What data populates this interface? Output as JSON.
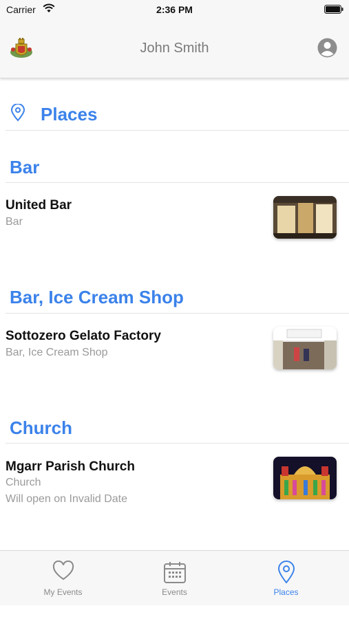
{
  "status_bar": {
    "carrier": "Carrier",
    "time": "2:36 PM"
  },
  "header": {
    "title": "John Smith",
    "logo_icon": "coat-of-arms-icon",
    "profile_icon": "person-circle-icon"
  },
  "page": {
    "title": "Places",
    "icon": "map-pin-icon"
  },
  "sections": [
    {
      "title": "Bar",
      "items": [
        {
          "name": "United Bar",
          "category": "Bar",
          "note": ""
        }
      ]
    },
    {
      "title": "Bar, Ice Cream Shop",
      "items": [
        {
          "name": "Sottozero Gelato Factory",
          "category": "Bar, Ice Cream Shop",
          "note": ""
        }
      ]
    },
    {
      "title": "Church",
      "items": [
        {
          "name": "Mgarr Parish Church",
          "category": "Church",
          "note": "Will open on Invalid Date"
        }
      ]
    }
  ],
  "tabs": [
    {
      "label": "My Events",
      "icon": "heart-icon",
      "active": false
    },
    {
      "label": "Events",
      "icon": "calendar-icon",
      "active": false
    },
    {
      "label": "Places",
      "icon": "map-pin-icon",
      "active": true
    }
  ],
  "colors": {
    "accent": "#3b82ea",
    "muted": "#9a9a9a",
    "bar_bg": "#f7f7f7"
  }
}
